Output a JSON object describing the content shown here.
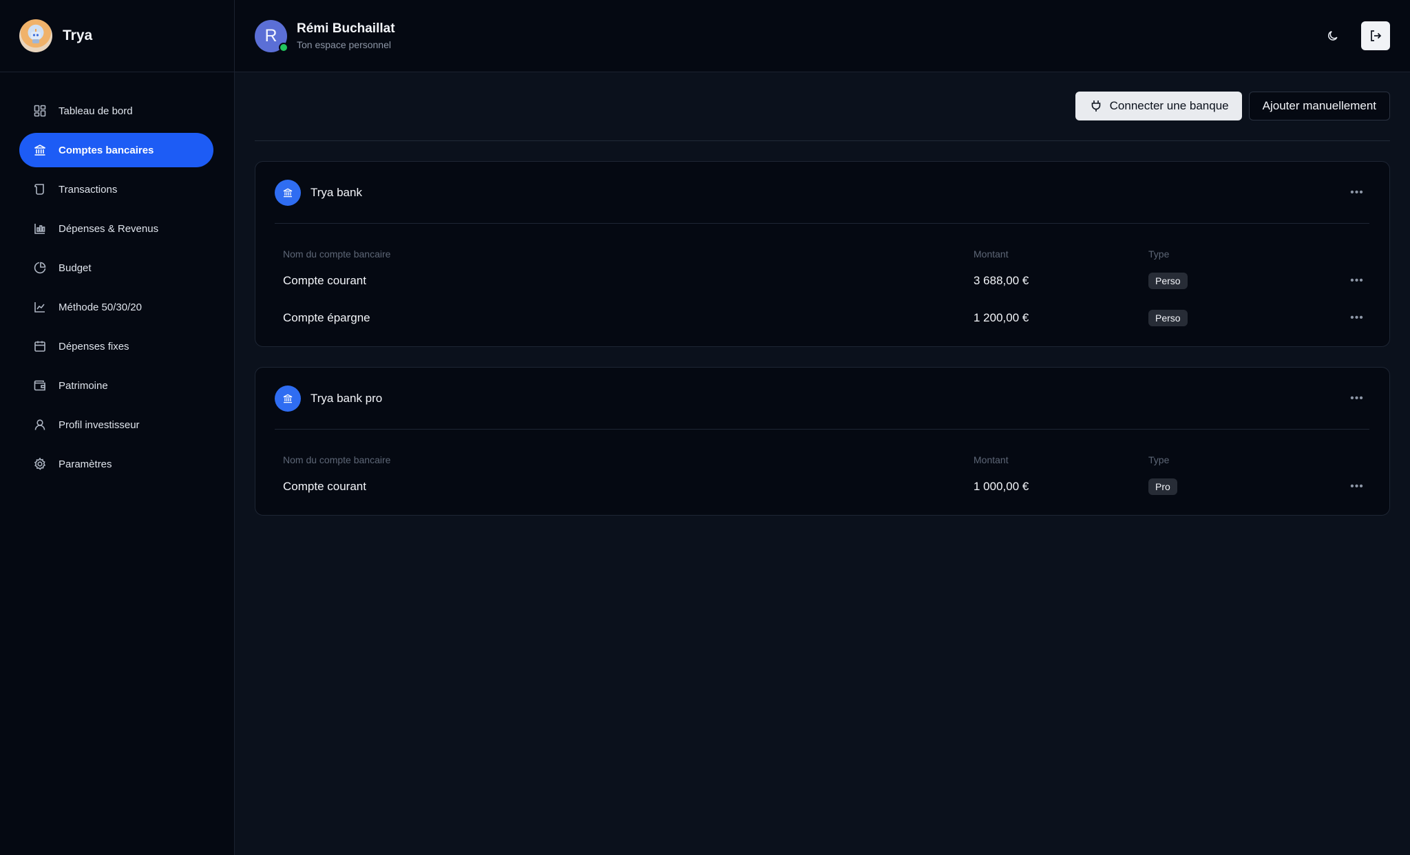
{
  "brand": {
    "name": "Trya"
  },
  "sidebar": {
    "items": [
      {
        "label": "Tableau de bord",
        "icon": "dashboard-icon"
      },
      {
        "label": "Comptes bancaires",
        "icon": "bank-icon",
        "active": true
      },
      {
        "label": "Transactions",
        "icon": "scroll-icon"
      },
      {
        "label": "Dépenses & Revenus",
        "icon": "bar-chart-icon"
      },
      {
        "label": "Budget",
        "icon": "pie-chart-icon"
      },
      {
        "label": "Méthode 50/30/20",
        "icon": "line-chart-icon"
      },
      {
        "label": "Dépenses fixes",
        "icon": "calendar-icon"
      },
      {
        "label": "Patrimoine",
        "icon": "wallet-icon"
      },
      {
        "label": "Profil investisseur",
        "icon": "user-icon"
      },
      {
        "label": "Paramètres",
        "icon": "gear-icon"
      }
    ]
  },
  "header": {
    "avatar_initial": "R",
    "user_name": "Rémi Buchaillat",
    "subtitle": "Ton espace personnel"
  },
  "toolbar": {
    "connect_label": "Connecter une banque",
    "manual_label": "Ajouter manuellement"
  },
  "columns": {
    "name": "Nom du compte bancaire",
    "amount": "Montant",
    "type": "Type"
  },
  "banks": [
    {
      "name": "Trya bank",
      "accounts": [
        {
          "name": "Compte courant",
          "amount": "3 688,00 €",
          "type": "Perso"
        },
        {
          "name": "Compte épargne",
          "amount": "1 200,00 €",
          "type": "Perso"
        }
      ]
    },
    {
      "name": "Trya bank pro",
      "accounts": [
        {
          "name": "Compte courant",
          "amount": "1 000,00 €",
          "type": "Pro"
        }
      ]
    }
  ],
  "colors": {
    "accent": "#1d5cf5",
    "bank_icon": "#2f6df2",
    "online": "#22c55e"
  }
}
